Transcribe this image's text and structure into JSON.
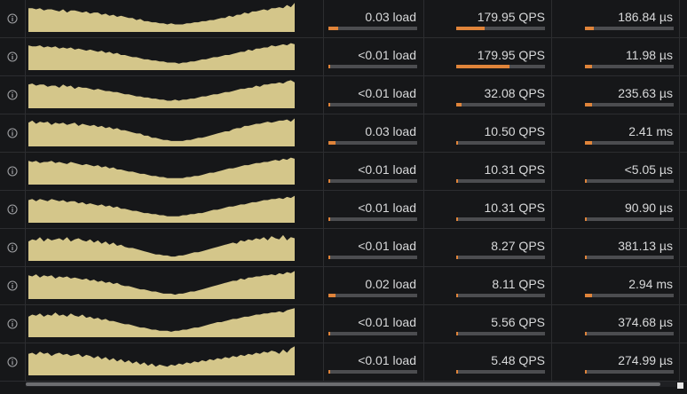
{
  "colors": {
    "sparkline": "#d4c68a",
    "bar_fill": "#e0843a",
    "bar_track": "#4c4d50"
  },
  "rows": [
    {
      "load": "0.03 load",
      "load_frac": 0.11,
      "qps": "179.95 QPS",
      "qps_frac": 0.32,
      "latency": "186.84 µs",
      "latency_frac": 0.1,
      "spark": [
        22,
        22,
        21,
        22,
        20,
        21,
        21,
        20,
        19,
        21,
        18,
        20,
        20,
        19,
        18,
        19,
        17,
        18,
        18,
        16,
        17,
        15,
        16,
        14,
        15,
        14,
        13,
        13,
        11,
        12,
        10,
        10,
        9,
        9,
        8,
        8,
        7,
        8,
        7,
        7,
        7,
        8,
        8,
        9,
        9,
        10,
        10,
        11,
        11,
        12,
        13,
        13,
        15,
        14,
        16,
        16,
        18,
        17,
        19,
        19,
        20,
        21,
        20,
        22,
        22,
        23,
        22,
        25,
        23,
        27
      ]
    },
    {
      "load": "<0.01 load",
      "load_frac": 0.02,
      "qps": "179.95 QPS",
      "qps_frac": 0.6,
      "latency": "11.98 µs",
      "latency_frac": 0.08,
      "spark": [
        23,
        22,
        22,
        23,
        21,
        22,
        21,
        22,
        20,
        21,
        20,
        21,
        19,
        20,
        19,
        18,
        19,
        18,
        17,
        18,
        16,
        17,
        15,
        16,
        14,
        14,
        13,
        12,
        12,
        11,
        10,
        10,
        9,
        9,
        8,
        8,
        7,
        7,
        7,
        6,
        7,
        7,
        8,
        8,
        9,
        10,
        10,
        11,
        12,
        12,
        13,
        14,
        14,
        15,
        16,
        17,
        17,
        19,
        18,
        20,
        20,
        21,
        21,
        23,
        22,
        23,
        24,
        23,
        25,
        24
      ]
    },
    {
      "load": "<0.01 load",
      "load_frac": 0.02,
      "qps": "32.08 QPS",
      "qps_frac": 0.06,
      "latency": "235.63 µs",
      "latency_frac": 0.08,
      "spark": [
        22,
        23,
        21,
        22,
        22,
        20,
        21,
        21,
        19,
        22,
        20,
        21,
        18,
        20,
        19,
        19,
        18,
        17,
        18,
        17,
        16,
        16,
        15,
        15,
        14,
        13,
        13,
        12,
        11,
        11,
        10,
        10,
        9,
        9,
        8,
        8,
        7,
        7,
        8,
        7,
        8,
        8,
        9,
        9,
        10,
        11,
        11,
        12,
        13,
        13,
        14,
        15,
        15,
        16,
        17,
        18,
        18,
        19,
        19,
        21,
        20,
        22,
        22,
        23,
        23,
        24,
        23,
        25,
        26,
        24
      ]
    },
    {
      "load": "0.03 load",
      "load_frac": 0.08,
      "qps": "10.50 QPS",
      "qps_frac": 0.02,
      "latency": "2.41 ms",
      "latency_frac": 0.08,
      "spark": [
        22,
        24,
        21,
        23,
        22,
        23,
        20,
        22,
        21,
        22,
        20,
        21,
        22,
        19,
        21,
        20,
        19,
        20,
        18,
        19,
        17,
        18,
        16,
        17,
        15,
        15,
        14,
        13,
        12,
        12,
        10,
        10,
        8,
        8,
        7,
        6,
        6,
        5,
        5,
        5,
        5,
        6,
        6,
        7,
        8,
        8,
        9,
        10,
        11,
        12,
        13,
        14,
        14,
        16,
        17,
        17,
        19,
        19,
        20,
        21,
        21,
        22,
        23,
        22,
        23,
        24,
        24,
        25,
        23,
        26
      ]
    },
    {
      "load": "<0.01 load",
      "load_frac": 0.02,
      "qps": "10.31 QPS",
      "qps_frac": 0.02,
      "latency": "<5.05 µs",
      "latency_frac": 0.02,
      "spark": [
        22,
        21,
        22,
        20,
        21,
        21,
        22,
        20,
        21,
        20,
        19,
        21,
        20,
        19,
        18,
        19,
        18,
        17,
        18,
        16,
        17,
        15,
        16,
        14,
        14,
        13,
        12,
        12,
        11,
        10,
        10,
        9,
        8,
        8,
        7,
        7,
        6,
        6,
        6,
        6,
        6,
        7,
        7,
        8,
        8,
        9,
        10,
        11,
        11,
        12,
        13,
        14,
        15,
        15,
        16,
        17,
        18,
        18,
        19,
        20,
        20,
        21,
        21,
        22,
        23,
        22,
        24,
        23,
        25,
        24
      ]
    },
    {
      "load": "<0.01 load",
      "load_frac": 0.02,
      "qps": "10.31 QPS",
      "qps_frac": 0.02,
      "latency": "90.90 µs",
      "latency_frac": 0.02,
      "spark": [
        21,
        22,
        20,
        22,
        21,
        20,
        22,
        21,
        20,
        21,
        19,
        20,
        20,
        18,
        19,
        17,
        18,
        17,
        16,
        17,
        15,
        16,
        14,
        15,
        13,
        13,
        12,
        11,
        11,
        10,
        9,
        9,
        8,
        8,
        7,
        7,
        6,
        6,
        6,
        6,
        7,
        7,
        8,
        8,
        9,
        9,
        10,
        11,
        12,
        12,
        13,
        14,
        15,
        15,
        16,
        17,
        17,
        18,
        19,
        19,
        20,
        21,
        21,
        22,
        22,
        23,
        22,
        24,
        23,
        25
      ]
    },
    {
      "load": "<0.01 load",
      "load_frac": 0.02,
      "qps": "8.27 QPS",
      "qps_frac": 0.02,
      "latency": "381.13 µs",
      "latency_frac": 0.02,
      "spark": [
        18,
        20,
        19,
        22,
        18,
        21,
        19,
        20,
        21,
        19,
        22,
        18,
        20,
        21,
        19,
        18,
        20,
        17,
        19,
        16,
        18,
        15,
        17,
        14,
        15,
        13,
        12,
        12,
        11,
        10,
        9,
        8,
        7,
        6,
        6,
        5,
        5,
        4,
        4,
        5,
        5,
        6,
        7,
        8,
        8,
        9,
        10,
        11,
        12,
        13,
        14,
        15,
        16,
        17,
        16,
        19,
        18,
        20,
        19,
        21,
        20,
        22,
        19,
        23,
        21,
        20,
        24,
        19,
        22,
        21
      ]
    },
    {
      "load": "0.02 load",
      "load_frac": 0.08,
      "qps": "8.11 QPS",
      "qps_frac": 0.02,
      "latency": "2.94 ms",
      "latency_frac": 0.08,
      "spark": [
        22,
        21,
        23,
        20,
        22,
        21,
        22,
        19,
        21,
        20,
        21,
        19,
        20,
        19,
        18,
        19,
        17,
        18,
        16,
        17,
        15,
        16,
        14,
        15,
        13,
        12,
        12,
        11,
        10,
        9,
        9,
        8,
        7,
        7,
        6,
        5,
        5,
        5,
        4,
        5,
        5,
        6,
        7,
        7,
        8,
        9,
        10,
        11,
        12,
        13,
        14,
        15,
        16,
        17,
        17,
        19,
        18,
        20,
        20,
        21,
        21,
        22,
        22,
        23,
        22,
        24,
        23,
        25,
        24,
        26
      ]
    },
    {
      "load": "<0.01 load",
      "load_frac": 0.02,
      "qps": "5.56 QPS",
      "qps_frac": 0.02,
      "latency": "374.68 µs",
      "latency_frac": 0.02,
      "spark": [
        19,
        21,
        20,
        22,
        19,
        21,
        20,
        23,
        20,
        21,
        19,
        22,
        20,
        19,
        21,
        18,
        19,
        17,
        18,
        16,
        17,
        15,
        15,
        14,
        13,
        12,
        12,
        11,
        10,
        9,
        9,
        8,
        7,
        7,
        6,
        6,
        6,
        5,
        6,
        6,
        7,
        7,
        8,
        9,
        9,
        10,
        11,
        12,
        13,
        14,
        14,
        15,
        16,
        17,
        17,
        18,
        19,
        19,
        20,
        21,
        21,
        22,
        22,
        23,
        23,
        24,
        23,
        25,
        26,
        27
      ]
    },
    {
      "load": "<0.01 load",
      "load_frac": 0.02,
      "qps": "5.48 QPS",
      "qps_frac": 0.02,
      "latency": "274.99 µs",
      "latency_frac": 0.02,
      "spark": [
        20,
        21,
        19,
        22,
        20,
        21,
        18,
        20,
        21,
        19,
        20,
        18,
        19,
        20,
        17,
        19,
        18,
        16,
        18,
        15,
        17,
        14,
        16,
        13,
        15,
        12,
        14,
        11,
        13,
        10,
        12,
        9,
        11,
        8,
        10,
        9,
        8,
        10,
        9,
        11,
        10,
        12,
        11,
        13,
        12,
        14,
        13,
        15,
        14,
        16,
        15,
        17,
        16,
        18,
        17,
        19,
        18,
        20,
        19,
        21,
        20,
        22,
        21,
        23,
        22,
        20,
        24,
        21,
        25,
        27
      ]
    }
  ]
}
